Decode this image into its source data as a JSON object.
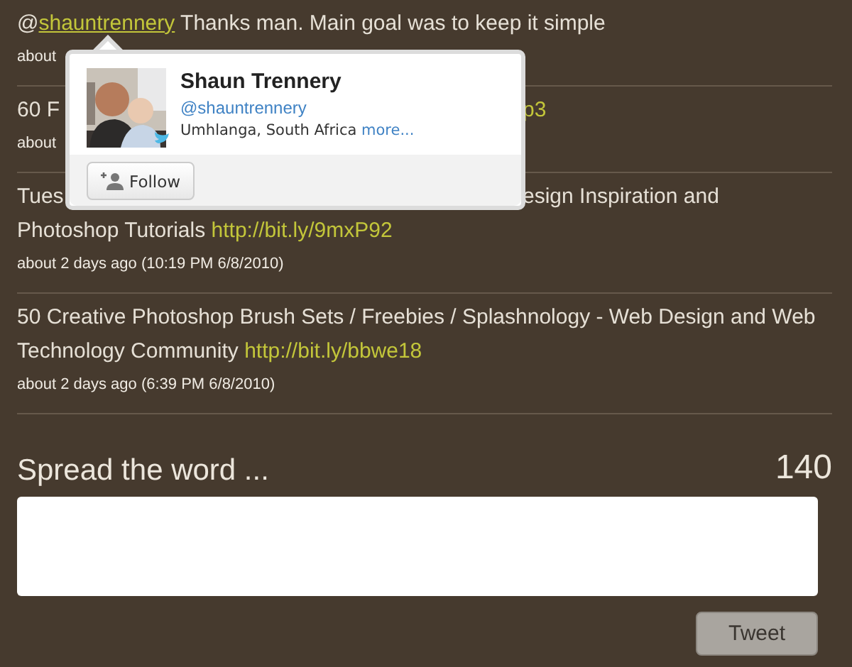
{
  "tweets": [
    {
      "lines": [
        {
          "parts": [
            {
              "kind": "plain",
              "text": "@"
            },
            {
              "kind": "link",
              "text": "shauntrennery",
              "underline": true
            },
            {
              "kind": "plain",
              "text": " Thanks man. Main goal was to keep it simple"
            }
          ]
        }
      ],
      "meta": "about"
    },
    {
      "lines": [
        {
          "parts": [
            {
              "kind": "plain",
              "text": "60 F"
            }
          ],
          "right": [
            {
              "kind": "link",
              "text": "p3"
            }
          ]
        }
      ],
      "meta": "about"
    },
    {
      "lines": [
        {
          "parts": [
            {
              "kind": "plain",
              "text": "Tues"
            }
          ],
          "right": [
            {
              "kind": "plain",
              "text": "esign Inspiration and"
            }
          ]
        },
        {
          "parts": [
            {
              "kind": "plain",
              "text": "Photoshop Tutorials "
            },
            {
              "kind": "link",
              "text": "http://bit.ly/9mxP92"
            }
          ]
        }
      ],
      "meta": "about 2 days ago (10:19 PM 6/8/2010)"
    },
    {
      "lines": [
        {
          "parts": [
            {
              "kind": "plain",
              "text": "50 Creative Photoshop Brush Sets / Freebies / Splashnology - Web Design and Web"
            }
          ]
        },
        {
          "parts": [
            {
              "kind": "plain",
              "text": "Technology Community "
            },
            {
              "kind": "link",
              "text": "http://bit.ly/bbwe18"
            }
          ]
        }
      ],
      "meta": "about 2 days ago (6:39 PM 6/8/2010)"
    }
  ],
  "hovercard": {
    "name": "Shaun Trennery",
    "handle": "@shauntrennery",
    "location": "Umhlanga, South Africa",
    "more": "more...",
    "follow": "Follow"
  },
  "composer": {
    "label": "Spread the word ...",
    "counter": "140",
    "button": "Tweet"
  }
}
